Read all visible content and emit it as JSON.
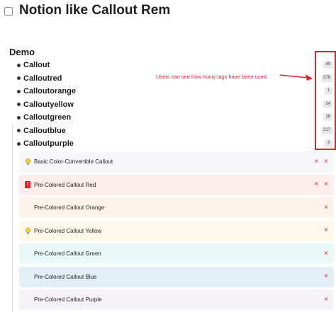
{
  "page": {
    "title": "Notion like Callout Rem",
    "demo_heading": "Demo"
  },
  "tags": [
    {
      "name": "Callout",
      "count": "49"
    },
    {
      "name": "Calloutred",
      "count": "378"
    },
    {
      "name": "Calloutorange",
      "count": "1"
    },
    {
      "name": "Calloutyellow",
      "count": "14"
    },
    {
      "name": "Calloutgreen",
      "count": "18"
    },
    {
      "name": "Calloutblue",
      "count": "217"
    },
    {
      "name": "Calloutpurple",
      "count": "3"
    }
  ],
  "annotation": {
    "text": "Users can see how many tags have been used.",
    "color": "#e0232b"
  },
  "callouts": [
    {
      "text": "Basic Color-Convertible Callout",
      "icon": "lightbulb-icon",
      "bg": "#f7f6fa",
      "actions": [
        "×",
        "×"
      ]
    },
    {
      "text": "Pre-Colored Callout Red",
      "icon": "red-badge-icon",
      "bg": "#fdecec",
      "actions": [
        "×",
        "×"
      ]
    },
    {
      "text": "Pre-Colored Callout Orange",
      "icon": "",
      "bg": "#fcf4ea",
      "actions": [
        "×"
      ]
    },
    {
      "text": "Pre-Colored Callout Yellow",
      "icon": "lightbulb-icon",
      "bg": "#fdf8ea",
      "actions": [
        "×"
      ]
    },
    {
      "text": "Pre-Colored Callout Green",
      "icon": "",
      "bg": "#e9f8f7",
      "actions": [
        "×"
      ]
    },
    {
      "text": "Pre-Colored Callout Blue",
      "icon": "",
      "bg": "#e3eff6",
      "actions": [
        "×"
      ]
    },
    {
      "text": "Pre-Colored Callout Purple",
      "icon": "",
      "bg": "#f5f3f8",
      "actions": [
        "×"
      ]
    }
  ],
  "colors": {
    "accent_red": "#e0232b",
    "count_badge_bg": "#e7e7ec"
  }
}
